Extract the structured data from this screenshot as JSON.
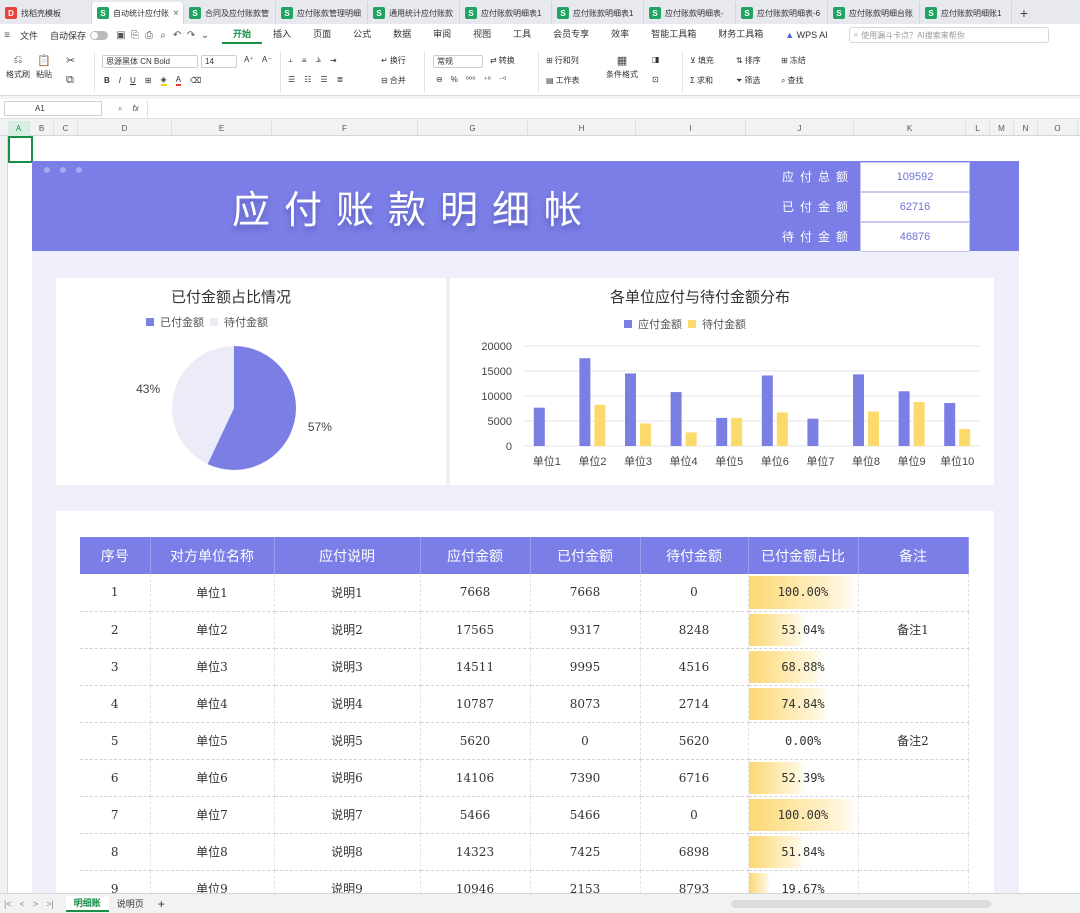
{
  "tabs": [
    {
      "label": "找稻壳模板",
      "icon": "D",
      "active": false
    },
    {
      "label": "自动统计应付账",
      "icon": "S",
      "active": true
    },
    {
      "label": "合同及应付账款管",
      "icon": "S",
      "active": false
    },
    {
      "label": "应付账款管理明细",
      "icon": "S",
      "active": false
    },
    {
      "label": "通用统计应付账款",
      "icon": "S",
      "active": false
    },
    {
      "label": "应付账款明细表1",
      "icon": "S",
      "active": false
    },
    {
      "label": "应付账款明细表1",
      "icon": "S",
      "active": false
    },
    {
      "label": "应付账款明细表-",
      "icon": "S",
      "active": false
    },
    {
      "label": "应付账款明细表-6",
      "icon": "S",
      "active": false
    },
    {
      "label": "应付账款明细台账",
      "icon": "S",
      "active": false
    },
    {
      "label": "应付账款明细账1",
      "icon": "S",
      "active": false
    }
  ],
  "menu": {
    "file": "文件",
    "autosave": "自动保存",
    "items": [
      "开始",
      "插入",
      "页面",
      "公式",
      "数据",
      "审阅",
      "视图",
      "工具",
      "会员专享",
      "效率",
      "智能工具箱",
      "财务工具箱"
    ],
    "active": "开始",
    "ai": "WPS AI",
    "search_placeholder": "使用漏斗卡点？AI搜索来帮你"
  },
  "ribbon": {
    "format_painter": "格式刷",
    "paste": "粘贴",
    "font_name": "思源黑体 CN Bold",
    "font_size": "14",
    "wrap": "换行",
    "merge": "合并",
    "number_format": "常规",
    "convert": "转换",
    "rows_cols": "行和列",
    "worksheet": "工作表",
    "cond_format": "条件格式",
    "fill": "填充",
    "sort": "排序",
    "freeze": "冻结",
    "sum": "求和",
    "filter": "筛选",
    "find": "查找"
  },
  "formula_bar": {
    "cell_ref": "A1",
    "fx": "fx",
    "value": ""
  },
  "columns": [
    "A",
    "B",
    "C",
    "D",
    "E",
    "F",
    "G",
    "H",
    "I",
    "J",
    "K",
    "L",
    "M",
    "N",
    "O"
  ],
  "dashboard": {
    "title": "应付账款明细帐",
    "kpis": [
      {
        "label": "应付总额",
        "value": "109592"
      },
      {
        "label": "已付金额",
        "value": "62716"
      },
      {
        "label": "待付金额",
        "value": "46876"
      }
    ],
    "colors": {
      "paid": "#7b7fe4",
      "pending": "#fbd96a",
      "unpaid_slice": "#ececf8",
      "header": "#7a7ee6"
    }
  },
  "chart_data": [
    {
      "type": "pie",
      "title": "已付金额占比情况",
      "labels": [
        "已付金额",
        "待付金额"
      ],
      "values": [
        57,
        43
      ],
      "value_labels": [
        "57%",
        "43%"
      ],
      "legend": "top"
    },
    {
      "type": "bar",
      "title": "各单位应付与待付金额分布",
      "categories": [
        "单位1",
        "单位2",
        "单位3",
        "单位4",
        "单位5",
        "单位6",
        "单位7",
        "单位8",
        "单位9",
        "单位10"
      ],
      "series": [
        {
          "name": "应付金额",
          "values": [
            7668,
            17565,
            14511,
            10787,
            5620,
            14106,
            5466,
            14323,
            10946,
            8600
          ]
        },
        {
          "name": "待付金额",
          "values": [
            0,
            8248,
            4516,
            2714,
            5620,
            6716,
            0,
            6898,
            8793,
            3400
          ]
        }
      ],
      "ylim": [
        0,
        20000
      ],
      "yticks": [
        "0",
        "5000",
        "10000",
        "15000",
        "20000"
      ],
      "grid": true,
      "legend": "top"
    }
  ],
  "table": {
    "headers": [
      "序号",
      "对方单位名称",
      "应付说明",
      "应付金额",
      "已付金额",
      "待付金额",
      "已付金额占比",
      "备注"
    ],
    "rows": [
      {
        "no": "1",
        "unit": "单位1",
        "desc": "说明1",
        "payable": "7668",
        "paid": "7668",
        "pending": "0",
        "ratio": "100.00%",
        "ratio_value": 1.0,
        "note": ""
      },
      {
        "no": "2",
        "unit": "单位2",
        "desc": "说明2",
        "payable": "17565",
        "paid": "9317",
        "pending": "8248",
        "ratio": "53.04%",
        "ratio_value": 0.5304,
        "note": "备注1"
      },
      {
        "no": "3",
        "unit": "单位3",
        "desc": "说明3",
        "payable": "14511",
        "paid": "9995",
        "pending": "4516",
        "ratio": "68.88%",
        "ratio_value": 0.6888,
        "note": ""
      },
      {
        "no": "4",
        "unit": "单位4",
        "desc": "说明4",
        "payable": "10787",
        "paid": "8073",
        "pending": "2714",
        "ratio": "74.84%",
        "ratio_value": 0.7484,
        "note": ""
      },
      {
        "no": "5",
        "unit": "单位5",
        "desc": "说明5",
        "payable": "5620",
        "paid": "0",
        "pending": "5620",
        "ratio": "0.00%",
        "ratio_value": 0.0,
        "note": "备注2"
      },
      {
        "no": "6",
        "unit": "单位6",
        "desc": "说明6",
        "payable": "14106",
        "paid": "7390",
        "pending": "6716",
        "ratio": "52.39%",
        "ratio_value": 0.5239,
        "note": ""
      },
      {
        "no": "7",
        "unit": "单位7",
        "desc": "说明7",
        "payable": "5466",
        "paid": "5466",
        "pending": "0",
        "ratio": "100.00%",
        "ratio_value": 1.0,
        "note": ""
      },
      {
        "no": "8",
        "unit": "单位8",
        "desc": "说明8",
        "payable": "14323",
        "paid": "7425",
        "pending": "6898",
        "ratio": "51.84%",
        "ratio_value": 0.5184,
        "note": ""
      },
      {
        "no": "9",
        "unit": "单位9",
        "desc": "说明9",
        "payable": "10946",
        "paid": "2153",
        "pending": "8793",
        "ratio": "19.67%",
        "ratio_value": 0.1967,
        "note": ""
      }
    ]
  },
  "sheet_tabs": [
    "明细账",
    "说明页"
  ],
  "active_sheet": "明细账"
}
